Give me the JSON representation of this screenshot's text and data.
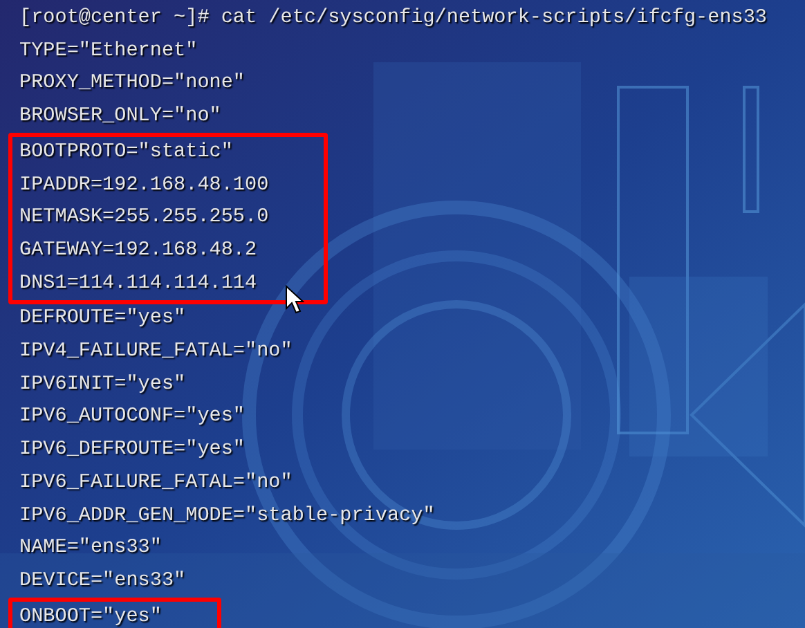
{
  "terminal": {
    "blocks": [
      {
        "highlighted": false,
        "lines": [
          "[root@center ~]# cat /etc/sysconfig/network-scripts/ifcfg-ens33",
          "TYPE=\"Ethernet\"",
          "PROXY_METHOD=\"none\"",
          "BROWSER_ONLY=\"no\""
        ]
      },
      {
        "highlighted": true,
        "lines": [
          "BOOTPROTO=\"static\"",
          "IPADDR=192.168.48.100",
          "NETMASK=255.255.255.0",
          "GATEWAY=192.168.48.2",
          "DNS1=114.114.114.114"
        ]
      },
      {
        "highlighted": false,
        "lines": [
          "DEFROUTE=\"yes\"",
          "IPV4_FAILURE_FATAL=\"no\"",
          "IPV6INIT=\"yes\"",
          "IPV6_AUTOCONF=\"yes\"",
          "IPV6_DEFROUTE=\"yes\"",
          "IPV6_FAILURE_FATAL=\"no\"",
          "IPV6_ADDR_GEN_MODE=\"stable-privacy\"",
          "NAME=\"ens33\"",
          "DEVICE=\"ens33\""
        ]
      },
      {
        "highlighted": true,
        "lines": [
          "ONBOOT=\"yes\""
        ]
      }
    ]
  }
}
